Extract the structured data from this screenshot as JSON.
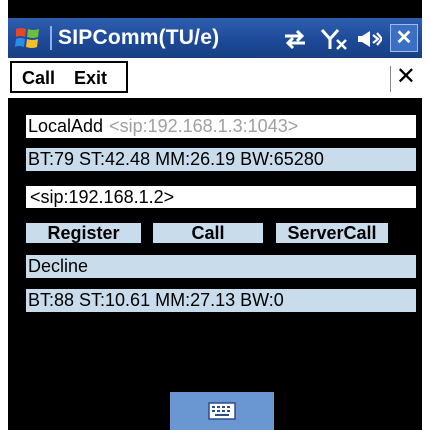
{
  "titlebar": {
    "title": "SIPComm(TU/e)",
    "icons": [
      "windows-logo-icon",
      "data-connection-icon",
      "signal-no-service-icon",
      "volume-icon",
      "close-icon"
    ],
    "close_label": "✕"
  },
  "menubar": {
    "call_label": "Call",
    "exit_label": "Exit",
    "close_label": "✕"
  },
  "local_address": {
    "label": "LocalAdd",
    "value": "<sip:192.168.1.3:1043>"
  },
  "stats_top": "BT:79 ST:42.48 MM:26.19 BW:65280",
  "remote_address": "<sip:192.168.1.2>",
  "buttons": {
    "register": "Register",
    "call": "Call",
    "server_call": "ServerCall"
  },
  "decline_label": "Decline",
  "stats_bottom": "BT:88 ST:10.61 MM:27.13 BW:0",
  "colors": {
    "title_bar": "#1d4898",
    "field_bg": "#c8dcec",
    "screen_bg": "#000000",
    "keyboard_tab": "#6a97d2"
  }
}
